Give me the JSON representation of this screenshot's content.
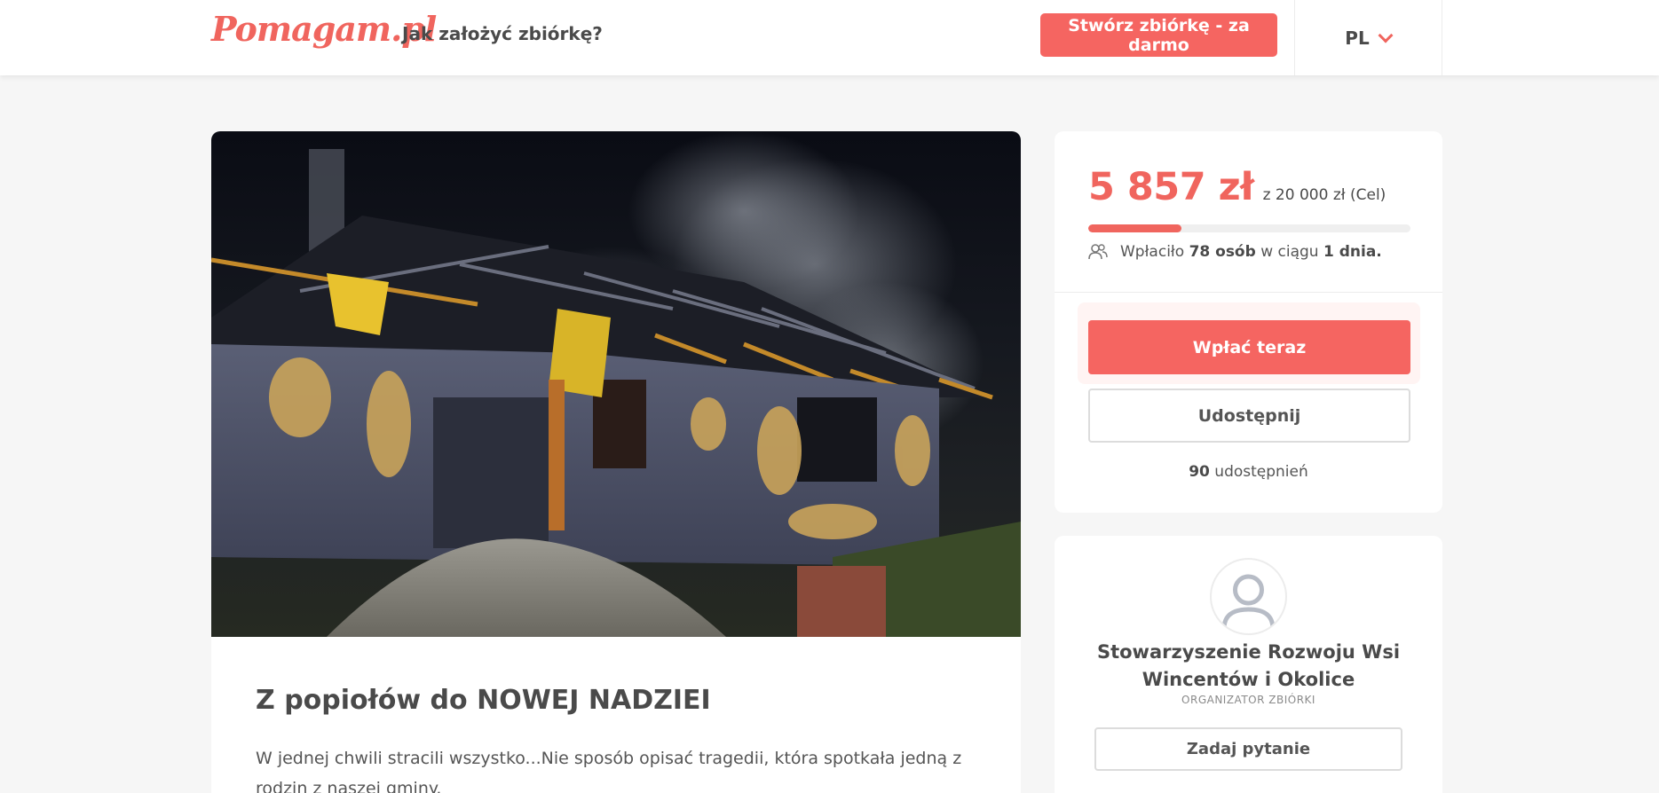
{
  "header": {
    "logo": "Pomagam.pl",
    "howto_link": "Jak założyć zbiórkę?",
    "create_button": "Stwórz zbiórkę - za darmo",
    "language": "PL"
  },
  "campaign": {
    "title": "Z popiołów do NOWEJ NADZIEI",
    "description": "W jednej chwili stracili wszystko...Nie sposób opisać tragedii, która spotkała jedną z rodzin z naszej gminy."
  },
  "funding": {
    "raised": "5 857 zł",
    "goal_text": "z 20 000 zł (Cel)",
    "progress_fraction": 0.29,
    "donors_prefix": "Wpłaciło",
    "donors_count": "78 osób",
    "donors_mid": "w ciągu",
    "donors_period": "1 dnia.",
    "donate_button": "Wpłać teraz",
    "share_button": "Udostępnij",
    "shares_count": "90",
    "shares_label": "udostępnień"
  },
  "organizer": {
    "name": "Stowarzyszenie Rozwoju Wsi Wincentów i Okolice",
    "role": "ORGANIZATOR ZBIÓRKI",
    "ask_button": "Zadaj pytanie"
  },
  "colors": {
    "accent": "#f0655e",
    "button": "#f56561",
    "background": "#f6f6f6"
  }
}
